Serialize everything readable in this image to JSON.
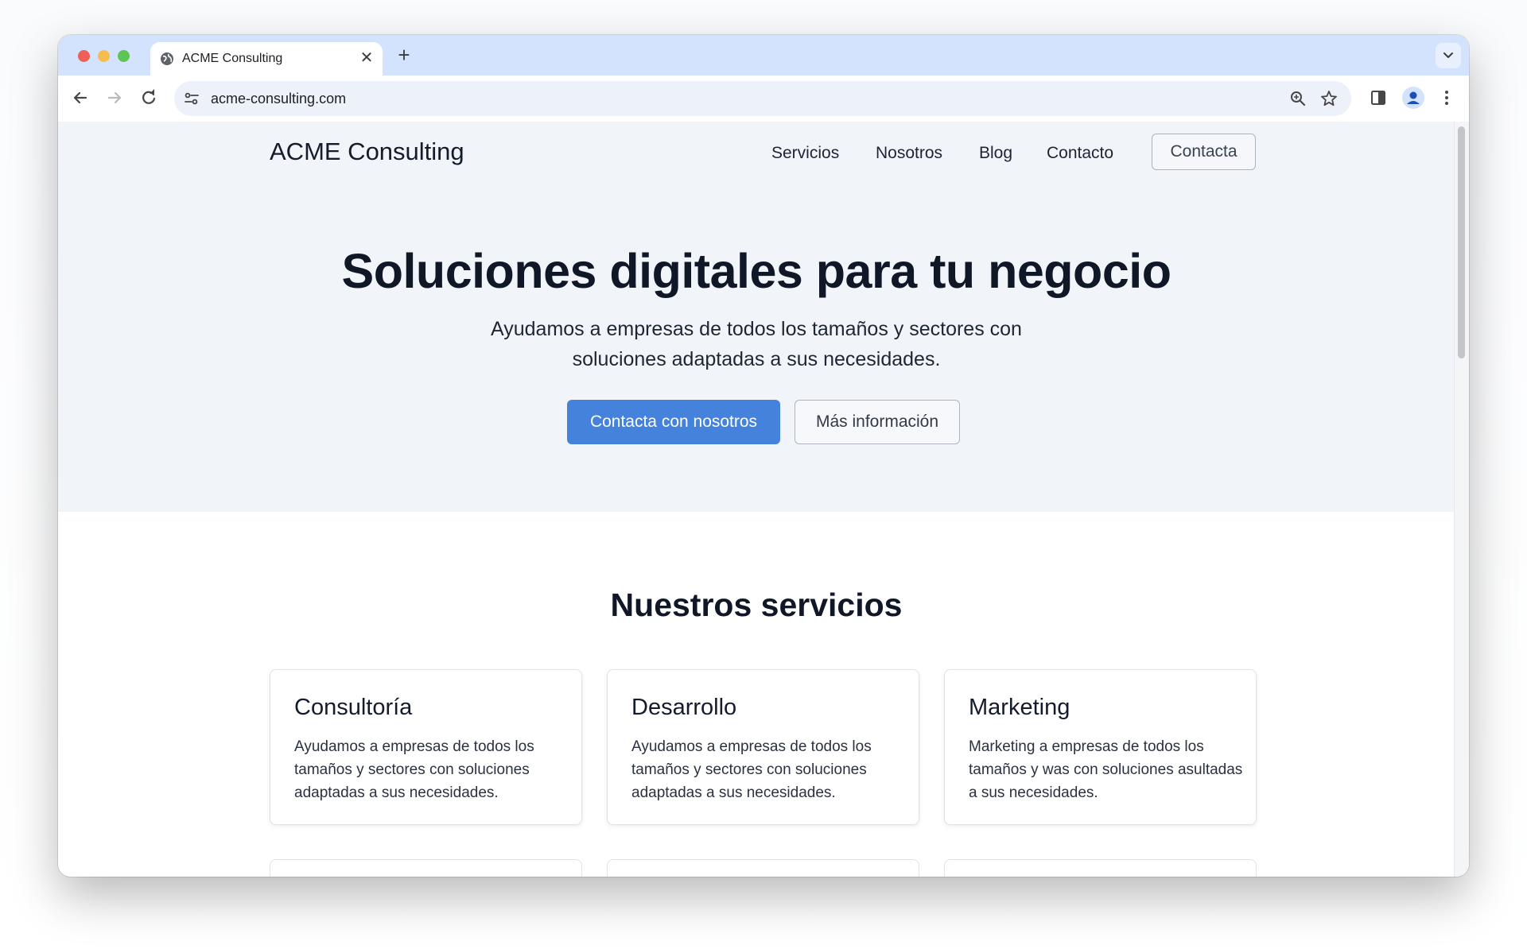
{
  "browser": {
    "tab_title": "ACME Consulting",
    "tab_close": "✕",
    "new_tab": "+",
    "url": "acme-consulting.com"
  },
  "header": {
    "brand": "ACME Consulting",
    "nav": [
      "Servicios",
      "Nosotros",
      "Blog",
      "Contacto"
    ],
    "cta": "Contacta"
  },
  "hero": {
    "title": "Soluciones digitales para tu negocio",
    "subtitle": "Ayudamos a empresas de todos los tamaños y sectores con soluciones adaptadas a sus necesidades.",
    "primary_button": "Contacta con nosotros",
    "secondary_button": "Más información"
  },
  "services": {
    "title": "Nuestros servicios",
    "cards": [
      {
        "title": "Consultoría",
        "body": "Ayudamos a empresas de todos los tamaños y sectores con soluciones adaptadas a sus necesidades."
      },
      {
        "title": "Desarrollo",
        "body": "Ayudamos a empresas de todos los tamaños y sectores con soluciones adaptadas a sus necesidades."
      },
      {
        "title": "Marketing",
        "body": "Marketing a empresas de todos los tamaños y was con soluciones asultadas a sus necesidades."
      }
    ]
  },
  "colors": {
    "tab_strip": "#d3e3fd",
    "hero_background": "#f1f4f9",
    "primary": "#4482db",
    "text_dark": "#101828"
  },
  "icons": {
    "favicon": "globe-icon",
    "back": "arrow-left-icon",
    "forward": "arrow-right-icon",
    "reload": "reload-icon",
    "site_info": "tune-icon",
    "zoom": "zoom-icon",
    "bookmark": "star-icon",
    "side_panel": "side-panel-icon",
    "profile": "profile-icon",
    "menu": "kebab-menu-icon",
    "tab_search": "chevron-down-icon"
  }
}
